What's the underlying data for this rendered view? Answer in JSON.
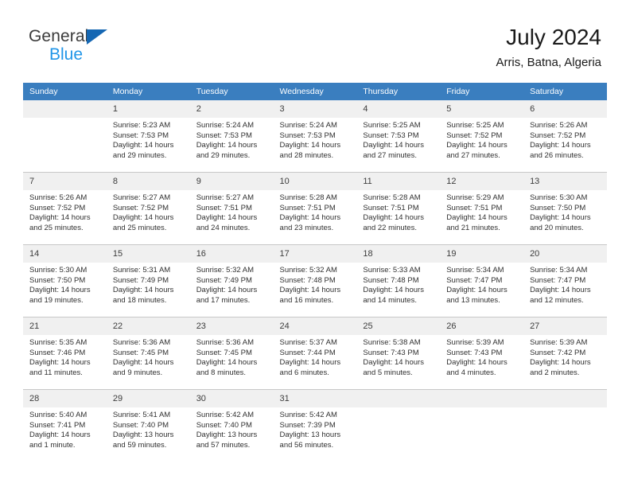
{
  "brand": {
    "name_top": "General",
    "name_bottom": "Blue",
    "accent_color": "#1567b3",
    "accent_light": "#2196e8"
  },
  "header": {
    "title": "July 2024",
    "subtitle": "Arris, Batna, Algeria"
  },
  "calendar": {
    "header_bg": "#3a7ebf",
    "daynum_bg": "#f0f0f0",
    "weekdays": [
      "Sunday",
      "Monday",
      "Tuesday",
      "Wednesday",
      "Thursday",
      "Friday",
      "Saturday"
    ],
    "weeks": [
      [
        {
          "day": "",
          "sunrise": "",
          "sunset": "",
          "daylight1": "",
          "daylight2": ""
        },
        {
          "day": "1",
          "sunrise": "Sunrise: 5:23 AM",
          "sunset": "Sunset: 7:53 PM",
          "daylight1": "Daylight: 14 hours",
          "daylight2": "and 29 minutes."
        },
        {
          "day": "2",
          "sunrise": "Sunrise: 5:24 AM",
          "sunset": "Sunset: 7:53 PM",
          "daylight1": "Daylight: 14 hours",
          "daylight2": "and 29 minutes."
        },
        {
          "day": "3",
          "sunrise": "Sunrise: 5:24 AM",
          "sunset": "Sunset: 7:53 PM",
          "daylight1": "Daylight: 14 hours",
          "daylight2": "and 28 minutes."
        },
        {
          "day": "4",
          "sunrise": "Sunrise: 5:25 AM",
          "sunset": "Sunset: 7:53 PM",
          "daylight1": "Daylight: 14 hours",
          "daylight2": "and 27 minutes."
        },
        {
          "day": "5",
          "sunrise": "Sunrise: 5:25 AM",
          "sunset": "Sunset: 7:52 PM",
          "daylight1": "Daylight: 14 hours",
          "daylight2": "and 27 minutes."
        },
        {
          "day": "6",
          "sunrise": "Sunrise: 5:26 AM",
          "sunset": "Sunset: 7:52 PM",
          "daylight1": "Daylight: 14 hours",
          "daylight2": "and 26 minutes."
        }
      ],
      [
        {
          "day": "7",
          "sunrise": "Sunrise: 5:26 AM",
          "sunset": "Sunset: 7:52 PM",
          "daylight1": "Daylight: 14 hours",
          "daylight2": "and 25 minutes."
        },
        {
          "day": "8",
          "sunrise": "Sunrise: 5:27 AM",
          "sunset": "Sunset: 7:52 PM",
          "daylight1": "Daylight: 14 hours",
          "daylight2": "and 25 minutes."
        },
        {
          "day": "9",
          "sunrise": "Sunrise: 5:27 AM",
          "sunset": "Sunset: 7:51 PM",
          "daylight1": "Daylight: 14 hours",
          "daylight2": "and 24 minutes."
        },
        {
          "day": "10",
          "sunrise": "Sunrise: 5:28 AM",
          "sunset": "Sunset: 7:51 PM",
          "daylight1": "Daylight: 14 hours",
          "daylight2": "and 23 minutes."
        },
        {
          "day": "11",
          "sunrise": "Sunrise: 5:28 AM",
          "sunset": "Sunset: 7:51 PM",
          "daylight1": "Daylight: 14 hours",
          "daylight2": "and 22 minutes."
        },
        {
          "day": "12",
          "sunrise": "Sunrise: 5:29 AM",
          "sunset": "Sunset: 7:51 PM",
          "daylight1": "Daylight: 14 hours",
          "daylight2": "and 21 minutes."
        },
        {
          "day": "13",
          "sunrise": "Sunrise: 5:30 AM",
          "sunset": "Sunset: 7:50 PM",
          "daylight1": "Daylight: 14 hours",
          "daylight2": "and 20 minutes."
        }
      ],
      [
        {
          "day": "14",
          "sunrise": "Sunrise: 5:30 AM",
          "sunset": "Sunset: 7:50 PM",
          "daylight1": "Daylight: 14 hours",
          "daylight2": "and 19 minutes."
        },
        {
          "day": "15",
          "sunrise": "Sunrise: 5:31 AM",
          "sunset": "Sunset: 7:49 PM",
          "daylight1": "Daylight: 14 hours",
          "daylight2": "and 18 minutes."
        },
        {
          "day": "16",
          "sunrise": "Sunrise: 5:32 AM",
          "sunset": "Sunset: 7:49 PM",
          "daylight1": "Daylight: 14 hours",
          "daylight2": "and 17 minutes."
        },
        {
          "day": "17",
          "sunrise": "Sunrise: 5:32 AM",
          "sunset": "Sunset: 7:48 PM",
          "daylight1": "Daylight: 14 hours",
          "daylight2": "and 16 minutes."
        },
        {
          "day": "18",
          "sunrise": "Sunrise: 5:33 AM",
          "sunset": "Sunset: 7:48 PM",
          "daylight1": "Daylight: 14 hours",
          "daylight2": "and 14 minutes."
        },
        {
          "day": "19",
          "sunrise": "Sunrise: 5:34 AM",
          "sunset": "Sunset: 7:47 PM",
          "daylight1": "Daylight: 14 hours",
          "daylight2": "and 13 minutes."
        },
        {
          "day": "20",
          "sunrise": "Sunrise: 5:34 AM",
          "sunset": "Sunset: 7:47 PM",
          "daylight1": "Daylight: 14 hours",
          "daylight2": "and 12 minutes."
        }
      ],
      [
        {
          "day": "21",
          "sunrise": "Sunrise: 5:35 AM",
          "sunset": "Sunset: 7:46 PM",
          "daylight1": "Daylight: 14 hours",
          "daylight2": "and 11 minutes."
        },
        {
          "day": "22",
          "sunrise": "Sunrise: 5:36 AM",
          "sunset": "Sunset: 7:45 PM",
          "daylight1": "Daylight: 14 hours",
          "daylight2": "and 9 minutes."
        },
        {
          "day": "23",
          "sunrise": "Sunrise: 5:36 AM",
          "sunset": "Sunset: 7:45 PM",
          "daylight1": "Daylight: 14 hours",
          "daylight2": "and 8 minutes."
        },
        {
          "day": "24",
          "sunrise": "Sunrise: 5:37 AM",
          "sunset": "Sunset: 7:44 PM",
          "daylight1": "Daylight: 14 hours",
          "daylight2": "and 6 minutes."
        },
        {
          "day": "25",
          "sunrise": "Sunrise: 5:38 AM",
          "sunset": "Sunset: 7:43 PM",
          "daylight1": "Daylight: 14 hours",
          "daylight2": "and 5 minutes."
        },
        {
          "day": "26",
          "sunrise": "Sunrise: 5:39 AM",
          "sunset": "Sunset: 7:43 PM",
          "daylight1": "Daylight: 14 hours",
          "daylight2": "and 4 minutes."
        },
        {
          "day": "27",
          "sunrise": "Sunrise: 5:39 AM",
          "sunset": "Sunset: 7:42 PM",
          "daylight1": "Daylight: 14 hours",
          "daylight2": "and 2 minutes."
        }
      ],
      [
        {
          "day": "28",
          "sunrise": "Sunrise: 5:40 AM",
          "sunset": "Sunset: 7:41 PM",
          "daylight1": "Daylight: 14 hours",
          "daylight2": "and 1 minute."
        },
        {
          "day": "29",
          "sunrise": "Sunrise: 5:41 AM",
          "sunset": "Sunset: 7:40 PM",
          "daylight1": "Daylight: 13 hours",
          "daylight2": "and 59 minutes."
        },
        {
          "day": "30",
          "sunrise": "Sunrise: 5:42 AM",
          "sunset": "Sunset: 7:40 PM",
          "daylight1": "Daylight: 13 hours",
          "daylight2": "and 57 minutes."
        },
        {
          "day": "31",
          "sunrise": "Sunrise: 5:42 AM",
          "sunset": "Sunset: 7:39 PM",
          "daylight1": "Daylight: 13 hours",
          "daylight2": "and 56 minutes."
        },
        {
          "day": "",
          "sunrise": "",
          "sunset": "",
          "daylight1": "",
          "daylight2": ""
        },
        {
          "day": "",
          "sunrise": "",
          "sunset": "",
          "daylight1": "",
          "daylight2": ""
        },
        {
          "day": "",
          "sunrise": "",
          "sunset": "",
          "daylight1": "",
          "daylight2": ""
        }
      ]
    ]
  }
}
